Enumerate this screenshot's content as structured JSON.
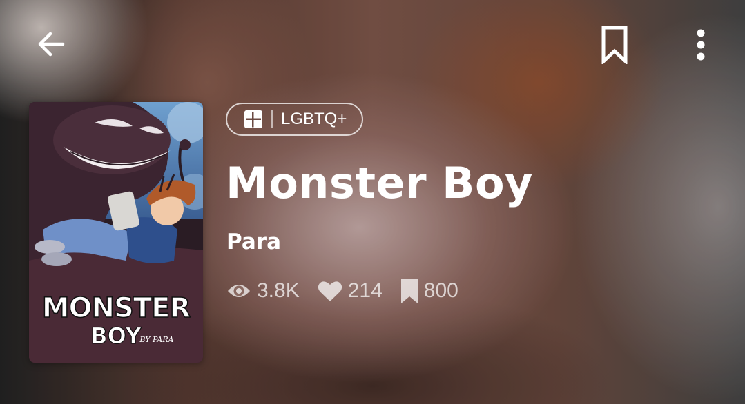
{
  "header": {
    "back_icon": "arrow-left-icon",
    "bookmark_icon": "bookmark-outline-icon",
    "more_icon": "more-vertical-icon"
  },
  "cover": {
    "title_art_top": "MONSTER",
    "title_art_bottom": "BOY",
    "byline_art": "BY PARA"
  },
  "genre": {
    "icon": "grid-icon",
    "label": "LGBTQ+"
  },
  "series": {
    "title": "Monster Boy",
    "author": "Para"
  },
  "stats": {
    "views": "3.8K",
    "views_icon": "eye-icon",
    "likes": "214",
    "likes_icon": "heart-icon",
    "subscribers": "800",
    "subscribers_icon": "bookmark-icon"
  },
  "colors": {
    "text_primary": "#ffffff",
    "text_muted": "rgba(255,255,255,0.72)"
  }
}
